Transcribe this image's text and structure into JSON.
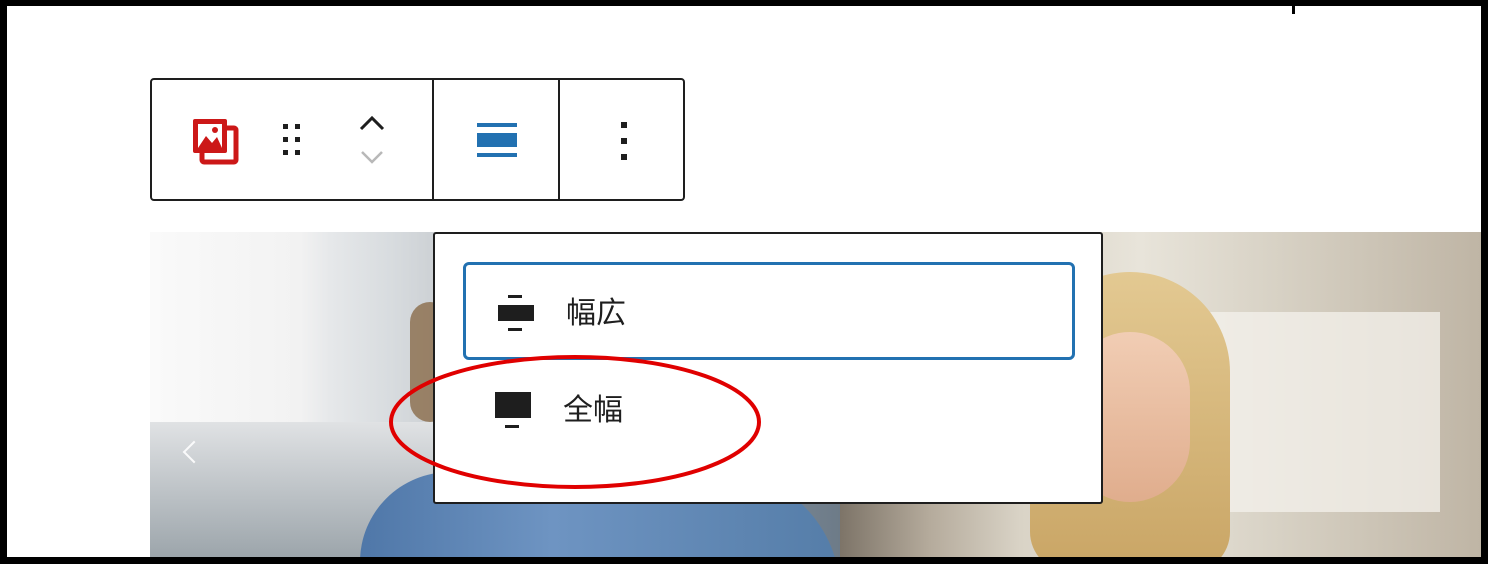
{
  "toolbar": {
    "block_icon": "gallery-icon",
    "drag_icon": "drag-handle-icon",
    "move_up_icon": "chevron-up-icon",
    "move_down_icon": "chevron-down-icon",
    "align_icon": "align-wide-icon",
    "more_icon": "more-vertical-icon"
  },
  "alignment_menu": {
    "items": [
      {
        "label": "幅広",
        "icon": "align-wide-icon",
        "selected": true
      },
      {
        "label": "全幅",
        "icon": "align-full-width-icon",
        "selected": false
      }
    ]
  },
  "colors": {
    "accent": "#2271b1",
    "brand_block_icon": "#cc1818",
    "annotation": "#e00000",
    "text": "#1e1e1e"
  }
}
